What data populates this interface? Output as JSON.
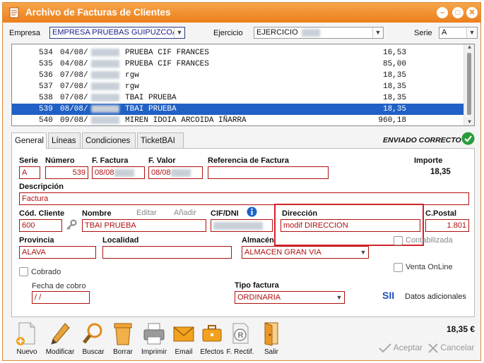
{
  "window": {
    "title": "Archivo de Facturas de Clientes"
  },
  "topbar": {
    "empresa_label": "Empresa",
    "empresa_value": "EMPRESA PRUEBAS GUIPUZCOA",
    "ejercicio_label": "Ejercicio",
    "ejercicio_value": "EJERCICIO",
    "serie_label": "Serie",
    "serie_value": "A"
  },
  "invoice_list": [
    {
      "num": "534",
      "date": "04/08/",
      "name": "PRUEBA CIF FRANCES",
      "amount": "16,53"
    },
    {
      "num": "535",
      "date": "04/08/",
      "name": "PRUEBA CIF FRANCES",
      "amount": "85,00"
    },
    {
      "num": "536",
      "date": "07/08/",
      "name": "rgw",
      "amount": "18,35"
    },
    {
      "num": "537",
      "date": "07/08/",
      "name": "rgw",
      "amount": "18,35"
    },
    {
      "num": "538",
      "date": "07/08/",
      "name": "TBAI PRUEBA",
      "amount": "18,35"
    },
    {
      "num": "539",
      "date": "08/08/",
      "name": "TBAI PRUEBA",
      "amount": "18,35"
    },
    {
      "num": "540",
      "date": "09/08/",
      "name": "MIREN IDOIA ARCOIDA IÑARRA",
      "amount": "960,18"
    }
  ],
  "tabs": [
    {
      "label": "General"
    },
    {
      "label": "Líneas"
    },
    {
      "label": "Condiciones"
    },
    {
      "label": "TicketBAI"
    }
  ],
  "status": {
    "text": "ENVIADO CORRECTO",
    "color": "#2a9d3a"
  },
  "form": {
    "serie_label": "Serie",
    "serie": "A",
    "numero_label": "Número",
    "numero": "539",
    "f_factura_label": "F. Factura",
    "f_factura": "08/08",
    "f_valor_label": "F. Valor",
    "f_valor": "08/08",
    "referencia_label": "Referencia de Factura",
    "referencia": "",
    "importe_label": "Importe",
    "importe": "18,35",
    "descripcion_label": "Descripción",
    "descripcion": "Factura",
    "cod_cliente_label": "Cód. Cliente",
    "cod_cliente": "600",
    "nombre_label": "Nombre",
    "nombre": "TBAI PRUEBA",
    "editar_label": "Editar",
    "anadir_label": "Añadir",
    "cif_label": "CIF/DNI",
    "direccion_label": "Dirección",
    "direccion": "modif DIRECCION",
    "cpostal_label": "C.Postal",
    "cpostal": "1.801",
    "provincia_label": "Provincia",
    "provincia": "ALAVA",
    "localidad_label": "Localidad",
    "localidad": "",
    "almacen_label": "Almacén",
    "almacen": "ALMACEN GRAN VIA",
    "contabilizada_label": "Contabilizada",
    "cobrado_label": "Cobrado",
    "venta_online_label": "Venta OnLine",
    "fecha_cobro_label": "Fecha de cobro",
    "fecha_cobro": " /  /",
    "tipo_factura_label": "Tipo factura",
    "tipo_factura": "ORDINARIA",
    "sii_label": "SII",
    "datos_adicionales_label": "Datos adicionales"
  },
  "total": "18,35 €",
  "toolbar": [
    {
      "label": "Nuevo",
      "icon": "new-document-icon"
    },
    {
      "label": "Modificar",
      "icon": "pencil-icon"
    },
    {
      "label": "Buscar",
      "icon": "magnifier-icon"
    },
    {
      "label": "Borrar",
      "icon": "trash-icon"
    },
    {
      "label": "Imprimir",
      "icon": "printer-icon"
    },
    {
      "label": "Email",
      "icon": "envelope-icon"
    },
    {
      "label": "Efectos",
      "icon": "briefcase-icon"
    },
    {
      "label": "F. Rectif.",
      "icon": "rectify-icon"
    },
    {
      "label": "Salir",
      "icon": "exit-door-icon"
    }
  ],
  "actions": {
    "accept": "Aceptar",
    "cancel": "Cancelar"
  }
}
